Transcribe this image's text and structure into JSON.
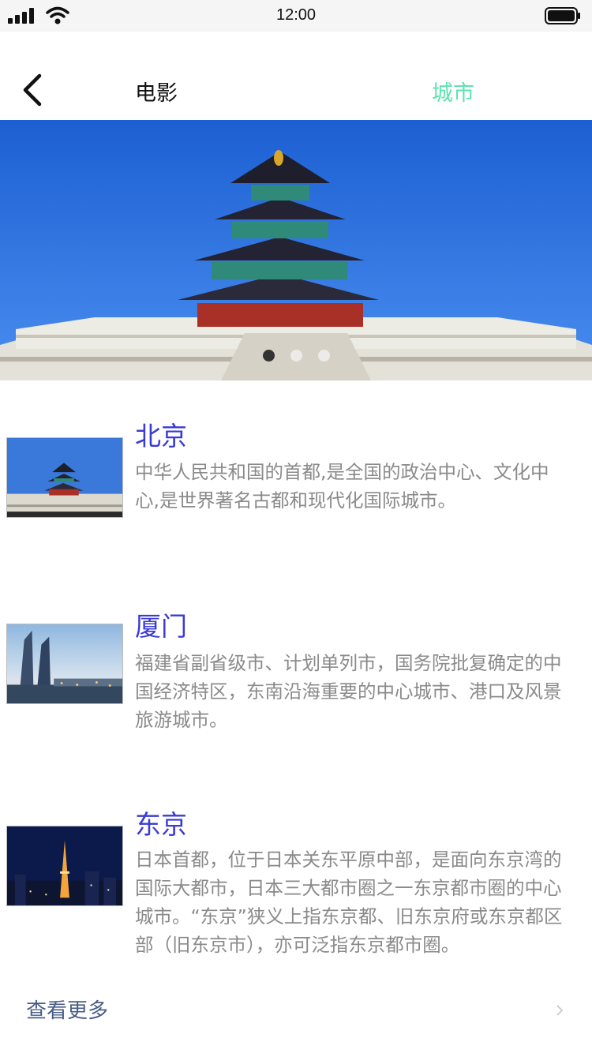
{
  "status_bar": {
    "time": "12:00"
  },
  "nav": {
    "tabs": [
      {
        "label": "电影"
      },
      {
        "label": "城市"
      }
    ],
    "colors": {
      "active_tab": "#5ee3b0"
    }
  },
  "banner": {
    "image": "temple-of-heaven",
    "dots": 3,
    "active_dot": 1
  },
  "cities": [
    {
      "name": "北京",
      "description": "中华人民共和国的首都,是全国的政治中心、文化中心,是世界著名古都和现代化国际城市。",
      "thumbnail": "temple-of-heaven"
    },
    {
      "name": "厦门",
      "description": "福建省副省级市、计划单列市，国务院批复确定的中国经济特区，东南沿海重要的中心城市、港口及风景旅游城市。",
      "thumbnail": "xiamen-skyline"
    },
    {
      "name": "东京",
      "description": "日本首都，位于日本关东平原中部，是面向东京湾的国际大都市，日本三大都市圈之一东京都市圈的中心城市。“东京”狭义上指东京都、旧东京府或东京都区部（旧东京市），亦可泛指东京都市圈。",
      "thumbnail": "tokyo-tower-night"
    }
  ],
  "footer": {
    "more_label": "查看更多"
  },
  "colors": {
    "city_name": "#3a3ad6",
    "description": "#8a8a8a",
    "more": "#4a5d86"
  }
}
